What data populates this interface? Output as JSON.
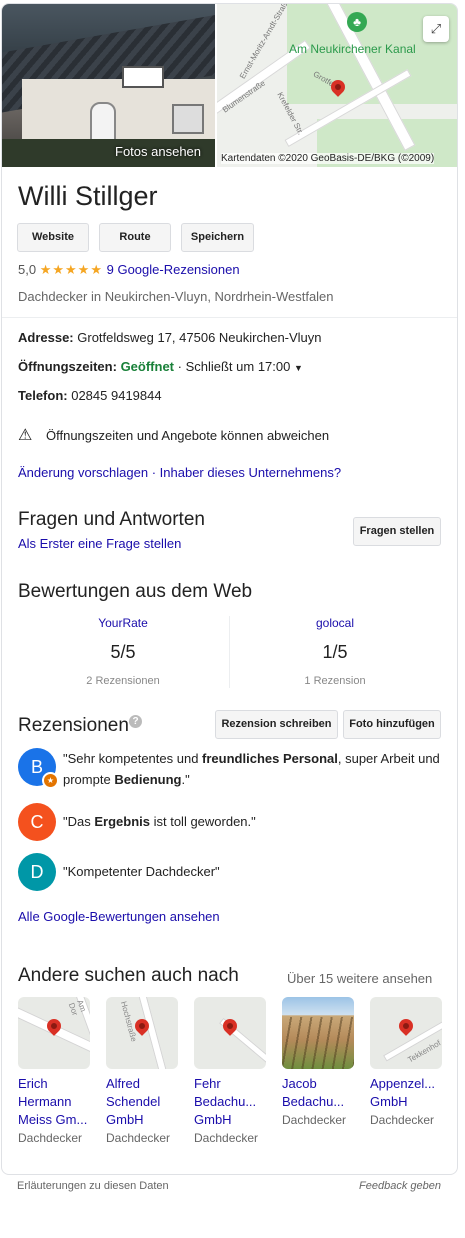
{
  "hero": {
    "photo_label": "Fotos ansehen",
    "map_credit": "Kartendaten ©2020 GeoBasis-DE/BKG (©2009)",
    "map_labels": {
      "canal": "Am Neukirchener Kanal",
      "street1": "Ernst-Moritz-Arndt-Straße",
      "street2": "Blumenstraße",
      "street3": "Krefelder Str.",
      "street4": "Grotfeld"
    }
  },
  "business": {
    "name": "Willi Stillger",
    "buttons": [
      "Website",
      "Route",
      "Speichern"
    ],
    "rating_value": "5,0",
    "stars": "★★★★★",
    "reviews_link": "9 Google-Rezensionen",
    "category": "Dachdecker in Neukirchen-Vluyn, Nordrhein-Westfalen"
  },
  "info": {
    "address_label": "Adresse:",
    "address": "Grotfeldsweg 17, 47506 Neukirchen-Vluyn",
    "hours_label": "Öffnungszeiten:",
    "hours_status": "Geöffnet",
    "hours_detail": "· Schließt um 17:00",
    "phone_label": "Telefon:",
    "phone": "02845 9419844",
    "warning": "Öffnungszeiten und Angebote können abweichen",
    "suggest_link": "Änderung vorschlagen",
    "sep": " · ",
    "owner_link": "Inhaber dieses Unternehmens?"
  },
  "qa": {
    "title": "Fragen und Antworten",
    "first_link": "Als Erster eine Frage stellen",
    "ask_button": "Fragen stellen"
  },
  "web_reviews": {
    "title": "Bewertungen aus dem Web",
    "sources": [
      {
        "name": "YourRate",
        "score": "5/5",
        "count": "2 Rezensionen"
      },
      {
        "name": "golocal",
        "score": "1/5",
        "count": "1 Rezension"
      }
    ]
  },
  "reviews": {
    "title": "Rezensionen",
    "help": "?",
    "write_button": "Rezension schreiben",
    "photo_button": "Foto hinzufügen",
    "items": [
      {
        "initial": "B",
        "color": "#1a73e8",
        "parts": [
          "\"Sehr kompetentes und ",
          "freundliches Personal",
          ", super Arbeit und prompte ",
          "Bedienung",
          ".\""
        ]
      },
      {
        "initial": "C",
        "color": "#f4511e",
        "parts": [
          "\"Das ",
          "Ergebnis",
          " ist toll geworden.\""
        ]
      },
      {
        "initial": "D",
        "color": "#0097a7",
        "parts": [
          "\"Kompetenter Dachdecker\""
        ]
      }
    ],
    "all_link": "Alle Google-Bewertungen ansehen"
  },
  "also_search": {
    "title": "Andere suchen auch nach",
    "more_link": "Über 15 weitere ansehen",
    "tiles": [
      {
        "name": "Erich Hermann Meiss Gm...",
        "category": "Dachdecker",
        "map_text": "Am Dor"
      },
      {
        "name": "Alfred Schendel GmbH",
        "category": "Dachdecker",
        "map_text": "Hochstraße"
      },
      {
        "name": "Fehr Bedachu... GmbH",
        "category": "Dachdecker",
        "map_text": ""
      },
      {
        "name": "Jacob Bedachu...",
        "category": "Dachdecker",
        "map_text": ""
      },
      {
        "name": "Appenzel... GmbH",
        "category": "Dachdecker",
        "map_text": "Tekkenhof"
      }
    ]
  },
  "footer": {
    "left": "Erläuterungen zu diesen Daten",
    "right": "Feedback geben"
  }
}
